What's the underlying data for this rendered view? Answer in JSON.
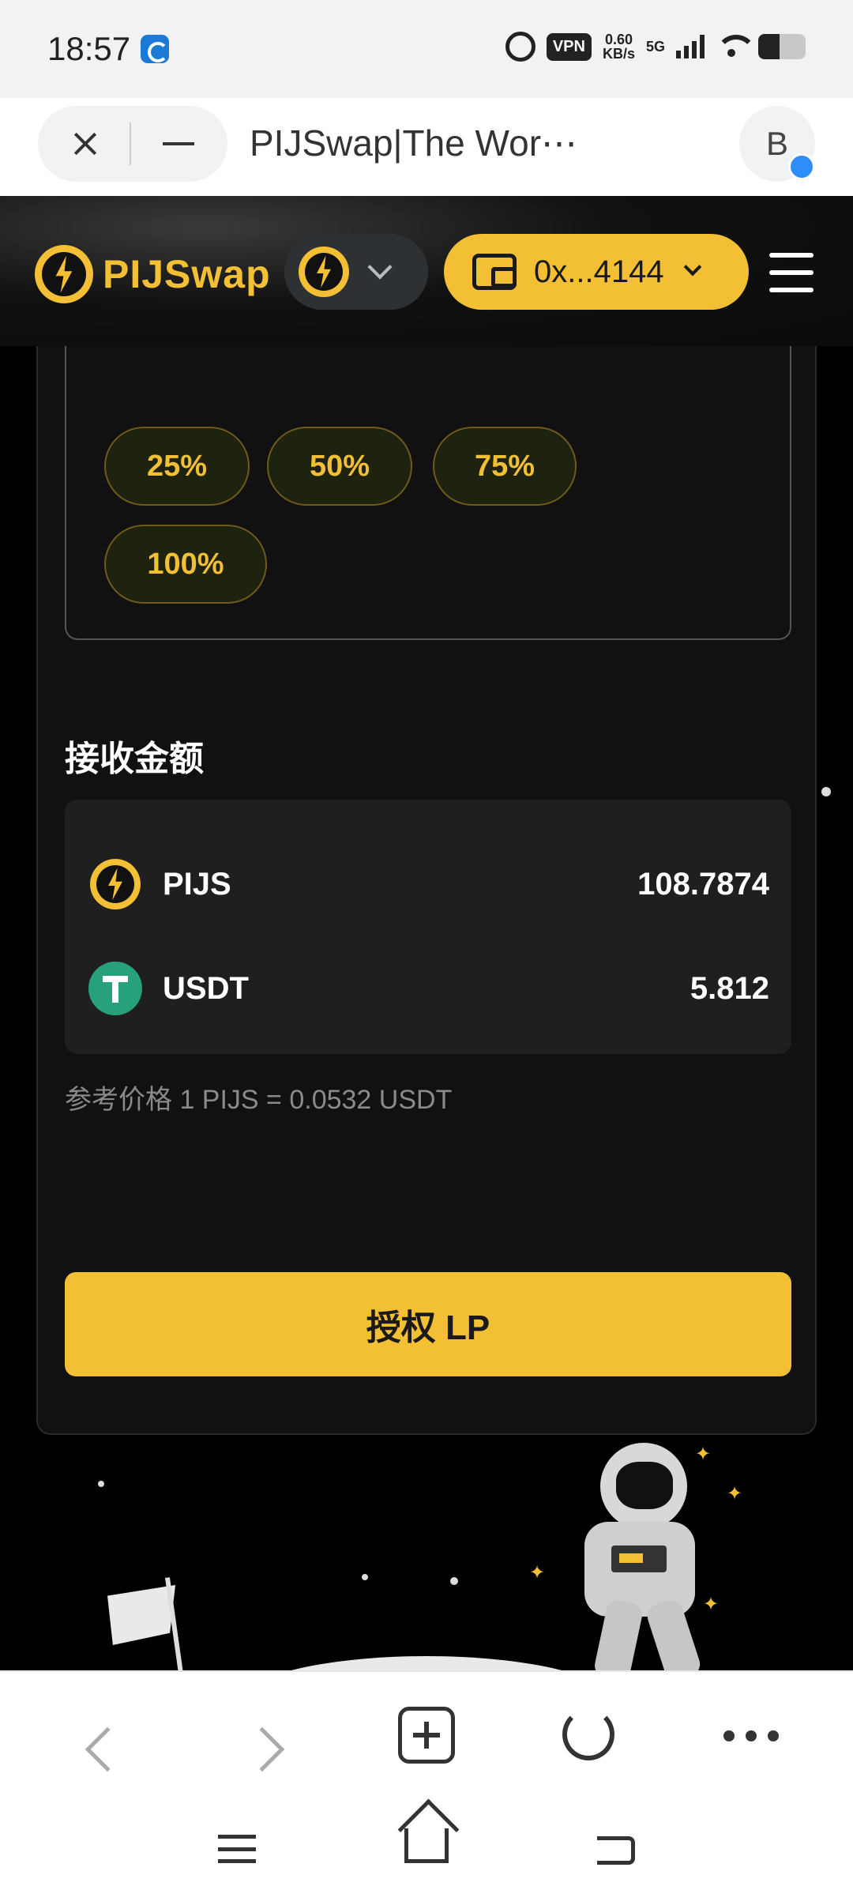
{
  "status_bar": {
    "time": "18:57",
    "vpn": "VPN",
    "speed_value": "0.60",
    "speed_unit": "KB/s",
    "network": "5G"
  },
  "browser": {
    "title": "PIJSwap|The Wor⋯",
    "avatar_letter": "B"
  },
  "header": {
    "logo_text": "PIJSwap",
    "wallet_address": "0x...4144"
  },
  "percent_buttons": [
    "25%",
    "50%",
    "75%",
    "100%"
  ],
  "receive": {
    "title": "接收金额",
    "tokens": [
      {
        "symbol": "PIJS",
        "amount": "108.7874",
        "icon": "pijs-bolt-icon"
      },
      {
        "symbol": "USDT",
        "amount": "5.812",
        "icon": "usdt-tether-icon"
      }
    ],
    "reference_price": "参考价格 1 PIJS = 0.0532 USDT"
  },
  "approve_button": "授权 LP",
  "colors": {
    "accent": "#f3bf34",
    "background": "#000000",
    "card": "#111111",
    "usdt": "#26a17b"
  }
}
